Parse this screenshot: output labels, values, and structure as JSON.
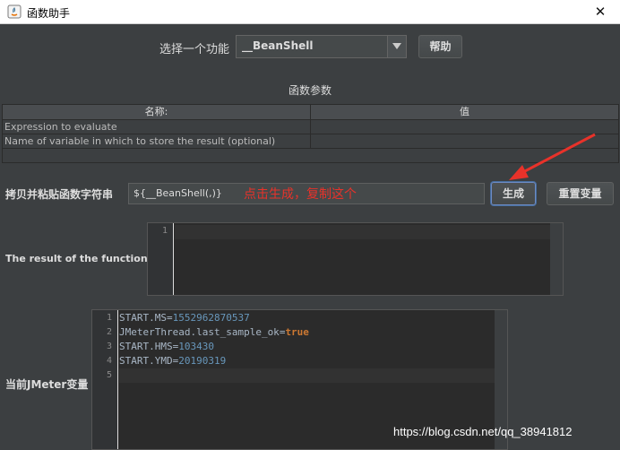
{
  "window": {
    "title": "函数助手"
  },
  "function_picker": {
    "label": "选择一个功能",
    "selected": "__BeanShell",
    "help_label": "帮助"
  },
  "params": {
    "section_title": "函数参数",
    "columns": [
      "名称:",
      "值"
    ],
    "rows": [
      {
        "name": "Expression to evaluate",
        "value": ""
      },
      {
        "name": "Name of variable in which to store the result (optional)",
        "value": ""
      }
    ]
  },
  "copy": {
    "label": "拷贝并粘贴函数字符串",
    "value": "${__BeanShell(,)}",
    "generate_label": "生成",
    "reset_label": "重置变量"
  },
  "annotation": {
    "text": "点击生成，复制这个",
    "color": "#e8322a"
  },
  "result": {
    "label": "The result of the function is",
    "lines": [
      ""
    ]
  },
  "jmeter_vars": {
    "label": "当前JMeter变量",
    "lines": [
      {
        "key": "START.MS",
        "value": "1552962870537"
      },
      {
        "key": "JMeterThread.last_sample_ok",
        "value": "true"
      },
      {
        "key": "START.HMS",
        "value": "103430"
      },
      {
        "key": "START.YMD",
        "value": "20190319"
      },
      {
        "key": "",
        "value": ""
      }
    ]
  },
  "watermark": "https://blog.csdn.net/qq_38941812",
  "colors": {
    "background": "#3c3f41",
    "editor_bg": "#2b2b2b",
    "number": "#6897bb",
    "keyword": "#cc7832",
    "focus_border": "#6d8bc4"
  }
}
